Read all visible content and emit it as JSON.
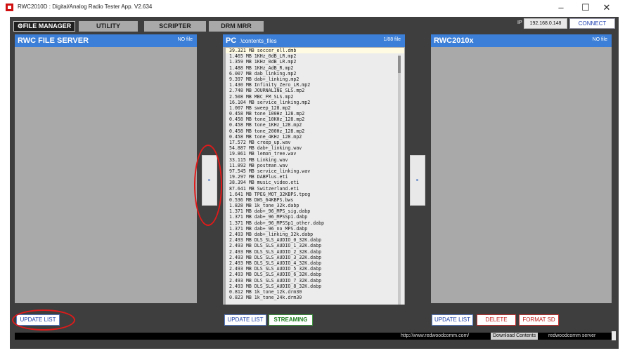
{
  "window": {
    "title": "RWC2010D : Digital/Analog Radio Tester App. V2.634",
    "minimize": "–",
    "maximize": "☐",
    "close": "✕"
  },
  "tabs": [
    {
      "label": "FILE MANAGER",
      "active": true
    },
    {
      "label": "UTILITY",
      "active": false
    },
    {
      "label": "SCRIPTER",
      "active": false
    },
    {
      "label": "DRM MRR",
      "active": false
    }
  ],
  "connection": {
    "ip_label": "IP",
    "ip_value": "192.168.0.148",
    "connect_label": "CONNECT"
  },
  "left_panel": {
    "title": "RWC FILE SERVER",
    "count": "NO file",
    "update_button": "UPDATE LIST"
  },
  "pc_panel": {
    "title": "PC",
    "path": ".\\contents_files",
    "count": "1/88 file",
    "update_button": "UPDATE LIST",
    "streaming_button": "STREAMING",
    "files": [
      {
        "size": "39.321",
        "unit": "MB",
        "name": "soccer_ell.dmb",
        "selected": true
      },
      {
        "size": "1.465",
        "unit": "MB",
        "name": "1KHz_0dB_LR.mp2"
      },
      {
        "size": "1.359",
        "unit": "MB",
        "name": "1KHz_0dB_LR.mp2"
      },
      {
        "size": "1.488",
        "unit": "MB",
        "name": "1KHz_AdB_R.mp2"
      },
      {
        "size": "6.007",
        "unit": "MB",
        "name": "dab_linking.mp2"
      },
      {
        "size": "9.397",
        "unit": "MB",
        "name": "dab+_linking.mp2"
      },
      {
        "size": "1.430",
        "unit": "MB",
        "name": "Infinity_Zero_LR.mp2"
      },
      {
        "size": "2.748",
        "unit": "MB",
        "name": "JOURNALINE_SLS.mp2"
      },
      {
        "size": "2.508",
        "unit": "MB",
        "name": "MBC_FM_SLS.mp2"
      },
      {
        "size": "16.104",
        "unit": "MB",
        "name": "service_linking.mp2"
      },
      {
        "size": "1.007",
        "unit": "MB",
        "name": "sweep_128.mp2"
      },
      {
        "size": "0.458",
        "unit": "MB",
        "name": "tone_100Hz_128.mp2"
      },
      {
        "size": "0.458",
        "unit": "MB",
        "name": "tone_10KHz_128.mp2"
      },
      {
        "size": "0.458",
        "unit": "MB",
        "name": "tone_1KHz_128.mp2"
      },
      {
        "size": "0.458",
        "unit": "MB",
        "name": "tone_200Hz_128.mp2"
      },
      {
        "size": "0.458",
        "unit": "MB",
        "name": "tone_4KHz_128.mp2"
      },
      {
        "size": "17.572",
        "unit": "MB",
        "name": "creep_up.wav"
      },
      {
        "size": "54.887",
        "unit": "MB",
        "name": "dab+_linking.wav"
      },
      {
        "size": "19.861",
        "unit": "MB",
        "name": "lemon_tree.wav"
      },
      {
        "size": "33.115",
        "unit": "MB",
        "name": "Linking.wav"
      },
      {
        "size": "11.892",
        "unit": "MB",
        "name": "postman.wav"
      },
      {
        "size": "97.545",
        "unit": "MB",
        "name": "service_linking.wav"
      },
      {
        "size": "19.297",
        "unit": "MB",
        "name": "DABPlus.eti"
      },
      {
        "size": "38.394",
        "unit": "MB",
        "name": "music_video.eti"
      },
      {
        "size": "87.641",
        "unit": "MB",
        "name": "Switzerland.eti"
      },
      {
        "size": "1.641",
        "unit": "MB",
        "name": "TPEG_MOT_32KBPS.tpeg"
      },
      {
        "size": "0.536",
        "unit": "MB",
        "name": "DWS_64KBPS.bws"
      },
      {
        "size": "1.828",
        "unit": "MB",
        "name": "1k_tone_32k.dabp"
      },
      {
        "size": "1.371",
        "unit": "MB",
        "name": "dab+_96_MPS_sig.dabp"
      },
      {
        "size": "1.371",
        "unit": "MB",
        "name": "dab+_96_MPSSp1.dabp"
      },
      {
        "size": "1.371",
        "unit": "MB",
        "name": "dab+_96_MPSSp1_other.dabp"
      },
      {
        "size": "1.371",
        "unit": "MB",
        "name": "dab+_96_no_MPS.dabp"
      },
      {
        "size": "2.493",
        "unit": "MB",
        "name": "dab+_linking_32k.dabp"
      },
      {
        "size": "2.493",
        "unit": "MB",
        "name": "DLS_SLS_AUDIO_0_32K.dabp"
      },
      {
        "size": "2.493",
        "unit": "MB",
        "name": "DLS_SLS_AUDIO_1_32K.dabp"
      },
      {
        "size": "2.493",
        "unit": "MB",
        "name": "DLS_SLS_AUDIO_2_32K.dabp"
      },
      {
        "size": "2.493",
        "unit": "MB",
        "name": "DLS_SLS_AUDIO_3_32K.dabp"
      },
      {
        "size": "2.493",
        "unit": "MB",
        "name": "DLS_SLS_AUDIO_4_32K.dabp"
      },
      {
        "size": "2.493",
        "unit": "MB",
        "name": "DLS_SLS_AUDIO_5_32K.dabp"
      },
      {
        "size": "2.493",
        "unit": "MB",
        "name": "DLS_SLS_AUDIO_6_32K.dabp"
      },
      {
        "size": "2.493",
        "unit": "MB",
        "name": "DLS_SLS_AUDIO_7_32K.dabp"
      },
      {
        "size": "2.493",
        "unit": "MB",
        "name": "DLS_SLS_AUDIO_8_32K.dabp"
      },
      {
        "size": "0.812",
        "unit": "MB",
        "name": "1k_tone_12k.drm30"
      },
      {
        "size": "0.823",
        "unit": "MB",
        "name": "1k_tone_24k.drm30"
      }
    ]
  },
  "right_panel": {
    "title": "RWC2010x",
    "count": "NO file",
    "update_button": "UPDATE LIST",
    "delete_button": "DELETE",
    "format_button": "FORMAT SD"
  },
  "transfer": {
    "to_server_glyph": "▸",
    "to_device_glyph": "▸"
  },
  "status_bar": {
    "url": "http://www.redwoodcomm.com/",
    "download_label": "Download Contents",
    "server_label": "redwoodcomm server"
  },
  "colors": {
    "header_blue": "#3b7fd8",
    "background_dark": "#3e3e3e",
    "panel_gray": "#a9a9a9",
    "annotation_red": "#e01a1a"
  }
}
